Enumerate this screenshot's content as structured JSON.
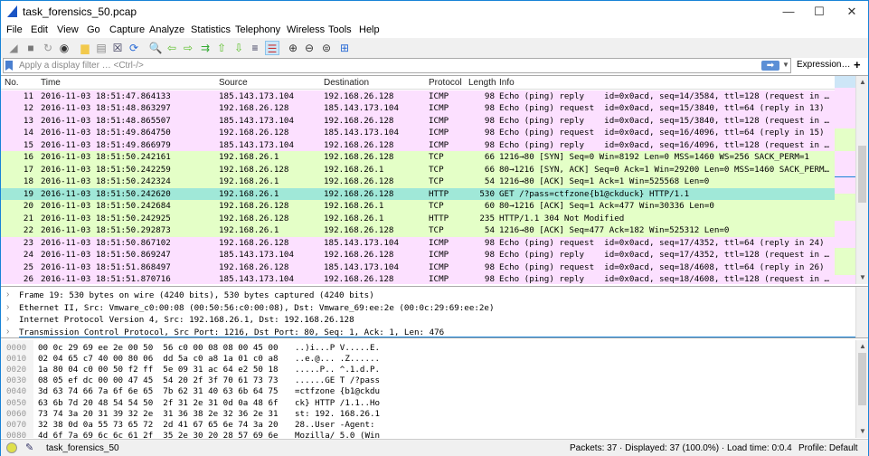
{
  "window": {
    "title": "task_forensics_50.pcap",
    "minimize": "—",
    "maximize": "☐",
    "close": "✕"
  },
  "menu": [
    "File",
    "Edit",
    "View",
    "Go",
    "Capture",
    "Analyze",
    "Statistics",
    "Telephony",
    "Wireless",
    "Tools",
    "Help"
  ],
  "toolbar_icons": [
    "shark-fin-start-icon",
    "stop-icon",
    "restart-icon",
    "options-gear-icon",
    "open-file-icon",
    "save-file-icon",
    "close-file-icon",
    "reload-icon",
    "find-icon",
    "back-icon",
    "forward-icon",
    "goto-packet-icon",
    "first-packet-icon",
    "last-packet-icon",
    "autoscroll-icon",
    "colorize-icon",
    "zoom-in-icon",
    "zoom-out-icon",
    "zoom-normal-icon",
    "resize-columns-icon"
  ],
  "filter": {
    "placeholder": "Apply a display filter … <Ctrl-/>",
    "expression": "Expression…",
    "plus": "+"
  },
  "columns": [
    "No.",
    "Time",
    "Source",
    "Destination",
    "Protocol",
    "Length",
    "Info"
  ],
  "colors": {
    "icmp": "#fce0ff",
    "tcp": "#e4ffc7",
    "selected": "#a0e8d8",
    "accent": "#1883d7"
  },
  "packets": [
    {
      "no": "11",
      "time": "2016-11-03 18:51:47.864133",
      "src": "185.143.173.104",
      "dst": "192.168.26.128",
      "proto": "ICMP",
      "len": "98",
      "info": "Echo (ping) reply    id=0x0acd, seq=14/3584, ttl=128 (request in …",
      "type": "icmp"
    },
    {
      "no": "12",
      "time": "2016-11-03 18:51:48.863297",
      "src": "192.168.26.128",
      "dst": "185.143.173.104",
      "proto": "ICMP",
      "len": "98",
      "info": "Echo (ping) request  id=0x0acd, seq=15/3840, ttl=64 (reply in 13)",
      "type": "icmp"
    },
    {
      "no": "13",
      "time": "2016-11-03 18:51:48.865507",
      "src": "185.143.173.104",
      "dst": "192.168.26.128",
      "proto": "ICMP",
      "len": "98",
      "info": "Echo (ping) reply    id=0x0acd, seq=15/3840, ttl=128 (request in …",
      "type": "icmp"
    },
    {
      "no": "14",
      "time": "2016-11-03 18:51:49.864750",
      "src": "192.168.26.128",
      "dst": "185.143.173.104",
      "proto": "ICMP",
      "len": "98",
      "info": "Echo (ping) request  id=0x0acd, seq=16/4096, ttl=64 (reply in 15)",
      "type": "icmp"
    },
    {
      "no": "15",
      "time": "2016-11-03 18:51:49.866979",
      "src": "185.143.173.104",
      "dst": "192.168.26.128",
      "proto": "ICMP",
      "len": "98",
      "info": "Echo (ping) reply    id=0x0acd, seq=16/4096, ttl=128 (request in …",
      "type": "icmp"
    },
    {
      "no": "16",
      "time": "2016-11-03 18:51:50.242161",
      "src": "192.168.26.1",
      "dst": "192.168.26.128",
      "proto": "TCP",
      "len": "66",
      "info": "1216→80 [SYN] Seq=0 Win=8192 Len=0 MSS=1460 WS=256 SACK_PERM=1",
      "type": "tcp"
    },
    {
      "no": "17",
      "time": "2016-11-03 18:51:50.242259",
      "src": "192.168.26.128",
      "dst": "192.168.26.1",
      "proto": "TCP",
      "len": "66",
      "info": "80→1216 [SYN, ACK] Seq=0 Ack=1 Win=29200 Len=0 MSS=1460 SACK_PERM…",
      "type": "tcp"
    },
    {
      "no": "18",
      "time": "2016-11-03 18:51:50.242324",
      "src": "192.168.26.1",
      "dst": "192.168.26.128",
      "proto": "TCP",
      "len": "54",
      "info": "1216→80 [ACK] Seq=1 Ack=1 Win=525568 Len=0",
      "type": "tcp"
    },
    {
      "no": "19",
      "time": "2016-11-03 18:51:50.242620",
      "src": "192.168.26.1",
      "dst": "192.168.26.128",
      "proto": "HTTP",
      "len": "530",
      "info": "GET /?pass=ctfzone{b1@ckduck} HTTP/1.1",
      "type": "selected"
    },
    {
      "no": "20",
      "time": "2016-11-03 18:51:50.242684",
      "src": "192.168.26.128",
      "dst": "192.168.26.1",
      "proto": "TCP",
      "len": "60",
      "info": "80→1216 [ACK] Seq=1 Ack=477 Win=30336 Len=0",
      "type": "tcp"
    },
    {
      "no": "21",
      "time": "2016-11-03 18:51:50.242925",
      "src": "192.168.26.128",
      "dst": "192.168.26.1",
      "proto": "HTTP",
      "len": "235",
      "info": "HTTP/1.1 304 Not Modified",
      "type": "tcp"
    },
    {
      "no": "22",
      "time": "2016-11-03 18:51:50.292873",
      "src": "192.168.26.1",
      "dst": "192.168.26.128",
      "proto": "TCP",
      "len": "54",
      "info": "1216→80 [ACK] Seq=477 Ack=182 Win=525312 Len=0",
      "type": "tcp"
    },
    {
      "no": "23",
      "time": "2016-11-03 18:51:50.867102",
      "src": "192.168.26.128",
      "dst": "185.143.173.104",
      "proto": "ICMP",
      "len": "98",
      "info": "Echo (ping) request  id=0x0acd, seq=17/4352, ttl=64 (reply in 24)",
      "type": "icmp"
    },
    {
      "no": "24",
      "time": "2016-11-03 18:51:50.869247",
      "src": "185.143.173.104",
      "dst": "192.168.26.128",
      "proto": "ICMP",
      "len": "98",
      "info": "Echo (ping) reply    id=0x0acd, seq=17/4352, ttl=128 (request in …",
      "type": "icmp"
    },
    {
      "no": "25",
      "time": "2016-11-03 18:51:51.868497",
      "src": "192.168.26.128",
      "dst": "185.143.173.104",
      "proto": "ICMP",
      "len": "98",
      "info": "Echo (ping) request  id=0x0acd, seq=18/4608, ttl=64 (reply in 26)",
      "type": "icmp"
    },
    {
      "no": "26",
      "time": "2016-11-03 18:51:51.870716",
      "src": "185.143.173.104",
      "dst": "192.168.26.128",
      "proto": "ICMP",
      "len": "98",
      "info": "Echo (ping) reply    id=0x0acd, seq=18/4608, ttl=128 (request in …",
      "type": "icmp"
    }
  ],
  "details": [
    "Frame 19: 530 bytes on wire (4240 bits), 530 bytes captured (4240 bits)",
    "Ethernet II, Src: Vmware_c0:00:08 (00:50:56:c0:00:08), Dst: Vmware_69:ee:2e (00:0c:29:69:ee:2e)",
    "Internet Protocol Version 4, Src: 192.168.26.1, Dst: 192.168.26.128",
    "Transmission Control Protocol, Src Port: 1216, Dst Port: 80, Seq: 1, Ack: 1, Len: 476"
  ],
  "hex": [
    {
      "off": "0000",
      "bytes": "00 0c 29 69 ee 2e 00 50  56 c0 00 08 08 00 45 00",
      "ascii": "..)i...P V.....E."
    },
    {
      "off": "0010",
      "bytes": "02 04 65 c7 40 00 80 06  dd 5a c0 a8 1a 01 c0 a8",
      "ascii": "..e.@... .Z......"
    },
    {
      "off": "0020",
      "bytes": "1a 80 04 c0 00 50 f2 ff  5e 09 31 ac 64 e2 50 18",
      "ascii": ".....P.. ^.1.d.P."
    },
    {
      "off": "0030",
      "bytes": "08 05 ef dc 00 00 47 45  54 20 2f 3f 70 61 73 73",
      "ascii": "......GE T /?pass"
    },
    {
      "off": "0040",
      "bytes": "3d 63 74 66 7a 6f 6e 65  7b 62 31 40 63 6b 64 75",
      "ascii": "=ctfzone {b1@ckdu"
    },
    {
      "off": "0050",
      "bytes": "63 6b 7d 20 48 54 54 50  2f 31 2e 31 0d 0a 48 6f",
      "ascii": "ck} HTTP /1.1..Ho"
    },
    {
      "off": "0060",
      "bytes": "73 74 3a 20 31 39 32 2e  31 36 38 2e 32 36 2e 31",
      "ascii": "st: 192. 168.26.1"
    },
    {
      "off": "0070",
      "bytes": "32 38 0d 0a 55 73 65 72  2d 41 67 65 6e 74 3a 20",
      "ascii": "28..User -Agent: "
    },
    {
      "off": "0080",
      "bytes": "4d 6f 7a 69 6c 6c 61 2f  35 2e 30 20 28 57 69 6e",
      "ascii": "Mozilla/ 5.0 (Win"
    }
  ],
  "status": {
    "file": "task_forensics_50",
    "packets": "Packets: 37 · Displayed: 37 (100.0%) · Load time: 0:0.4",
    "profile": "Profile: Default"
  }
}
